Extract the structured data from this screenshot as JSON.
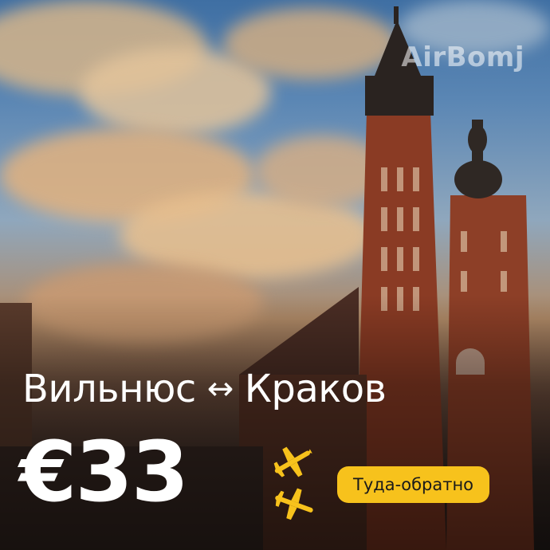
{
  "brand": {
    "logo_text": "AirBomj"
  },
  "route": {
    "origin": "Вильнюс",
    "arrow": "↔",
    "destination": "Краков"
  },
  "price": {
    "amount": "€33"
  },
  "trip_badge": {
    "label": "Туда-обратно"
  },
  "icons": {
    "planes": "airplane-icon",
    "accent_color": "#f7c21c"
  },
  "colors": {
    "text": "#ffffff",
    "badge_bg": "#f7c21c",
    "badge_text": "#1a1a1a"
  }
}
